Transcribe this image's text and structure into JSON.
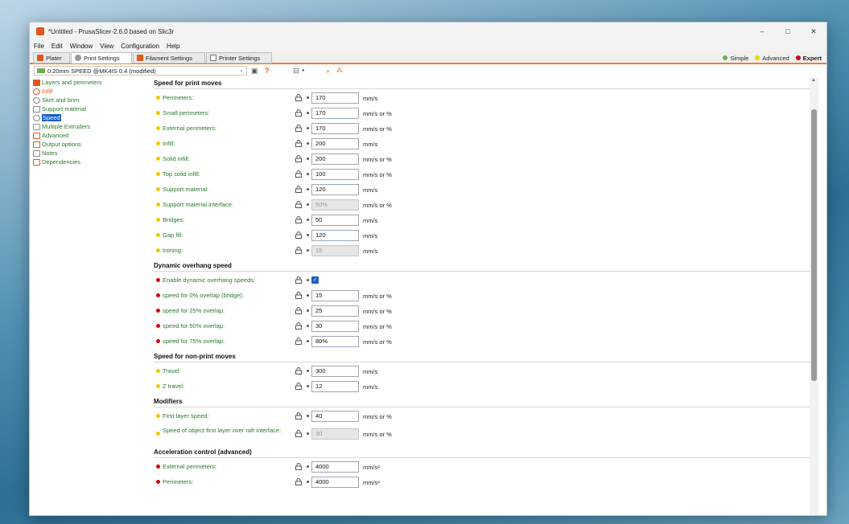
{
  "window": {
    "title": "*Untitled - PrusaSlicer-2.6.0 based on Slic3r",
    "controls": [
      "–",
      "□",
      "✕"
    ]
  },
  "menu": [
    "File",
    "Edit",
    "Window",
    "View",
    "Configuration",
    "Help"
  ],
  "tabs": [
    {
      "label": "Plater",
      "icon": "plater-icon",
      "color": "#e0581c"
    },
    {
      "label": "Print Settings",
      "icon": "gear-icon",
      "color": "#888888"
    },
    {
      "label": "Filament Settings",
      "icon": "spool-icon",
      "color": "#e0581c"
    },
    {
      "label": "Printer Settings",
      "icon": "printer-icon",
      "color": "#777777"
    }
  ],
  "modes": [
    {
      "label": "Simple",
      "color": "#6ab04c"
    },
    {
      "label": "Advanced",
      "color": "#f5d000"
    },
    {
      "label": "Expert",
      "color": "#d0021b"
    }
  ],
  "preset": {
    "name": "0.20mm SPEED @MK4IS 0.4 (modified)"
  },
  "sidebar": [
    {
      "label": "Layers and perimeters",
      "icon": "layers-icon"
    },
    {
      "label": "Infill",
      "icon": "infill-icon"
    },
    {
      "label": "Skirt and brim",
      "icon": "skirt-icon"
    },
    {
      "label": "Support material",
      "icon": "support-icon"
    },
    {
      "label": "Speed",
      "icon": "speed-icon",
      "selected": true
    },
    {
      "label": "Multiple Extruders",
      "icon": "extruders-icon"
    },
    {
      "label": "Advanced",
      "icon": "advanced-icon"
    },
    {
      "label": "Output options",
      "icon": "output-icon"
    },
    {
      "label": "Notes",
      "icon": "notes-icon"
    },
    {
      "label": "Dependencies",
      "icon": "dependencies-icon"
    }
  ],
  "sections": [
    {
      "title": "Speed for print moves",
      "rows": [
        {
          "label": "Perimeters:",
          "value": "170",
          "unit": "mm/s",
          "mode": "advanced"
        },
        {
          "label": "Small perimeters:",
          "value": "170",
          "unit": "mm/s or %",
          "mode": "advanced"
        },
        {
          "label": "External perimeters:",
          "value": "170",
          "unit": "mm/s or %",
          "mode": "advanced"
        },
        {
          "label": "Infill:",
          "value": "200",
          "unit": "mm/s",
          "mode": "advanced"
        },
        {
          "label": "Solid infill:",
          "value": "200",
          "unit": "mm/s or %",
          "mode": "advanced"
        },
        {
          "label": "Top solid infill:",
          "value": "100",
          "unit": "mm/s or %",
          "mode": "advanced"
        },
        {
          "label": "Support material:",
          "value": "120",
          "unit": "mm/s",
          "mode": "advanced"
        },
        {
          "label": "Support material interface:",
          "value": "50%",
          "unit": "mm/s or %",
          "mode": "advanced",
          "disabled": true
        },
        {
          "label": "Bridges:",
          "value": "50",
          "unit": "mm/s",
          "mode": "advanced"
        },
        {
          "label": "Gap fill:",
          "value": "120",
          "unit": "mm/s",
          "mode": "advanced"
        },
        {
          "label": "Ironing:",
          "value": "15",
          "unit": "mm/s",
          "mode": "advanced",
          "disabled": true
        }
      ]
    },
    {
      "title": "Dynamic overhang speed",
      "rows": [
        {
          "label": "Enable dynamic overhang speeds:",
          "checkbox": true,
          "mode": "expert"
        },
        {
          "label": "speed for 0% overlap (bridge):",
          "value": "15",
          "unit": "mm/s or %",
          "mode": "expert"
        },
        {
          "label": "speed for 25% overlap:",
          "value": "25",
          "unit": "mm/s or %",
          "mode": "expert"
        },
        {
          "label": "speed for 50% overlap:",
          "value": "30",
          "unit": "mm/s or %",
          "mode": "expert"
        },
        {
          "label": "speed for 75% overlap:",
          "value": "80%",
          "unit": "mm/s or %",
          "mode": "expert"
        }
      ]
    },
    {
      "title": "Speed for non-print moves",
      "rows": [
        {
          "label": "Travel:",
          "value": "300",
          "unit": "mm/s",
          "mode": "advanced"
        },
        {
          "label": "Z travel:",
          "value": "12",
          "unit": "mm/s",
          "mode": "advanced"
        }
      ]
    },
    {
      "title": "Modifiers",
      "rows": [
        {
          "label": "First layer speed:",
          "value": "40",
          "unit": "mm/s or %",
          "mode": "advanced"
        },
        {
          "label": "Speed of object first layer over raft interface:",
          "value": "30",
          "unit": "mm/s or %",
          "mode": "advanced",
          "disabled": true,
          "multiline": true
        }
      ]
    },
    {
      "title": "Acceleration control (advanced)",
      "rows": [
        {
          "label": "External perimeters:",
          "value": "4000",
          "unit": "mm/s²",
          "mode": "expert"
        },
        {
          "label": "Perimeters:",
          "value": "4000",
          "unit": "mm/s²",
          "mode": "expert"
        }
      ]
    }
  ]
}
